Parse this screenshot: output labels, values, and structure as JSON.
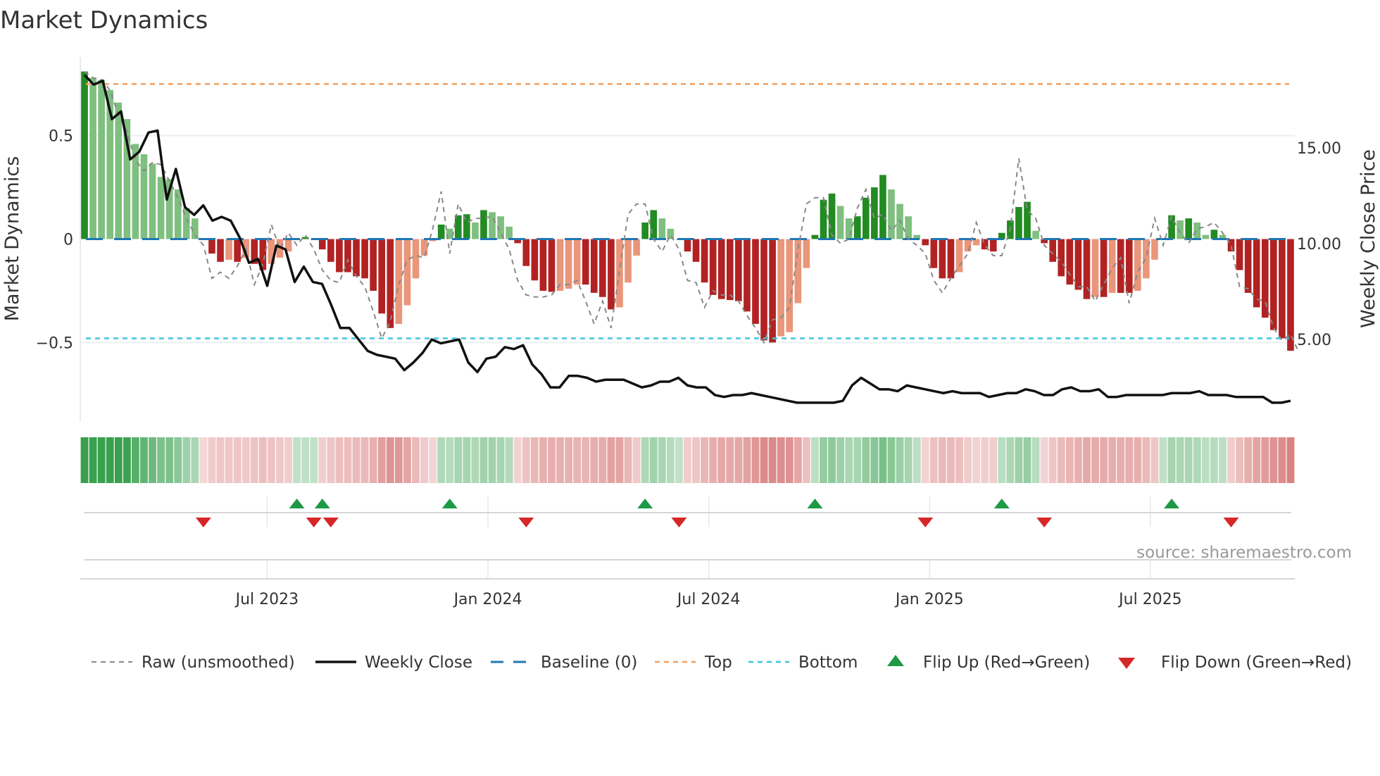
{
  "title": "Market Dynamics",
  "source": "source: sharemaestro.com",
  "chart_data": {
    "type": "bar",
    "title": "Market Dynamics",
    "ylabel": "Market Dynamics",
    "ylabel_right": "Weekly Close Price",
    "ylim": [
      -0.88,
      0.88
    ],
    "ylim_right": [
      0.74,
      19.74
    ],
    "yticks": [
      {
        "v": 0.5,
        "label": "0.5"
      },
      {
        "v": 0,
        "label": "0"
      },
      {
        "v": -0.5,
        "label": "−0.5"
      }
    ],
    "yticks_right": [
      {
        "v": 15,
        "label": "15.00"
      },
      {
        "v": 10,
        "label": "10.00"
      },
      {
        "v": 5,
        "label": "5.00"
      }
    ],
    "xticks": [
      {
        "week": 22,
        "label": "Jul 2023"
      },
      {
        "week": 48,
        "label": "Jan 2024"
      },
      {
        "week": 74,
        "label": "Jul 2024"
      },
      {
        "week": 100,
        "label": "Jan 2025"
      },
      {
        "week": 126,
        "label": "Jul 2025"
      }
    ],
    "top_level": 0.75,
    "bottom_level": -0.48,
    "baseline": 0,
    "values": [
      0.81,
      0.78,
      0.77,
      0.72,
      0.66,
      0.58,
      0.46,
      0.41,
      0.365,
      0.3,
      0.29,
      0.24,
      0.15,
      0.1,
      -0.005,
      -0.07,
      -0.11,
      -0.1,
      -0.11,
      -0.09,
      -0.12,
      -0.15,
      -0.12,
      -0.09,
      -0.06,
      0,
      0.01,
      0,
      -0.05,
      -0.11,
      -0.16,
      -0.16,
      -0.18,
      -0.19,
      -0.25,
      -0.36,
      -0.43,
      -0.41,
      -0.32,
      -0.19,
      -0.08,
      -0.01,
      0.07,
      0.05,
      0.115,
      0.12,
      0.08,
      0.14,
      0.13,
      0.11,
      0.06,
      -0.02,
      -0.13,
      -0.2,
      -0.25,
      -0.255,
      -0.25,
      -0.24,
      -0.22,
      -0.22,
      -0.26,
      -0.28,
      -0.34,
      -0.33,
      -0.21,
      -0.08,
      0.08,
      0.14,
      0.1,
      0.05,
      0,
      -0.06,
      -0.11,
      -0.21,
      -0.27,
      -0.29,
      -0.295,
      -0.3,
      -0.35,
      -0.41,
      -0.49,
      -0.5,
      -0.47,
      -0.45,
      -0.31,
      -0.14,
      0.02,
      0.19,
      0.22,
      0.16,
      0.1,
      0.11,
      0.2,
      0.25,
      0.31,
      0.24,
      0.17,
      0.11,
      0.02,
      -0.03,
      -0.14,
      -0.19,
      -0.19,
      -0.16,
      -0.06,
      -0.03,
      -0.05,
      -0.06,
      0.03,
      0.09,
      0.155,
      0.18,
      0.04,
      -0.02,
      -0.11,
      -0.18,
      -0.22,
      -0.245,
      -0.29,
      -0.28,
      -0.28,
      -0.26,
      -0.26,
      -0.26,
      -0.25,
      -0.19,
      -0.1,
      0,
      0.115,
      0.09,
      0.1,
      0.08,
      0.02,
      0.045,
      0.02,
      -0.06,
      -0.15,
      -0.26,
      -0.33,
      -0.38,
      -0.44,
      -0.48,
      -0.54
    ],
    "raw": [
      0.81,
      0.78,
      0.77,
      0.72,
      0.6,
      0.52,
      0.38,
      0.33,
      0.37,
      0.36,
      0.28,
      0.2,
      0.1,
      0.02,
      -0.03,
      -0.19,
      -0.16,
      -0.19,
      -0.13,
      -0.05,
      -0.22,
      -0.12,
      0.07,
      -0.05,
      0.03,
      -0.03,
      0.02,
      -0.05,
      -0.15,
      -0.2,
      -0.21,
      -0.1,
      -0.18,
      -0.23,
      -0.35,
      -0.48,
      -0.4,
      -0.22,
      -0.1,
      -0.08,
      -0.09,
      0.05,
      0.23,
      -0.07,
      0.17,
      0.08,
      0.1,
      0.1,
      0.11,
      0.03,
      -0.05,
      -0.2,
      -0.27,
      -0.28,
      -0.28,
      -0.27,
      -0.22,
      -0.22,
      -0.2,
      -0.3,
      -0.41,
      -0.3,
      -0.43,
      -0.15,
      0.12,
      0.17,
      0.17,
      0.0,
      -0.06,
      0.02,
      -0.05,
      -0.2,
      -0.21,
      -0.33,
      -0.25,
      -0.27,
      -0.27,
      -0.3,
      -0.37,
      -0.43,
      -0.5,
      -0.39,
      -0.38,
      -0.33,
      -0.05,
      0.17,
      0.2,
      0.2,
      0.02,
      -0.02,
      0.0,
      0.15,
      0.24,
      0.1,
      0.12,
      0.04,
      0.09,
      0.0,
      -0.03,
      -0.07,
      -0.2,
      -0.26,
      -0.19,
      -0.13,
      -0.07,
      0.08,
      -0.03,
      -0.08,
      -0.08,
      0.05,
      0.39,
      0.14,
      0.1,
      -0.03,
      -0.07,
      -0.11,
      -0.17,
      -0.23,
      -0.23,
      -0.3,
      -0.22,
      -0.14,
      -0.09,
      -0.31,
      -0.16,
      -0.09,
      0.1,
      -0.03,
      0.11,
      0.03,
      -0.02,
      0.05,
      0.06,
      0.08,
      0.03,
      -0.03,
      -0.23,
      -0.24,
      -0.29,
      -0.3,
      -0.43,
      -0.49,
      -0.46,
      -0.55
    ],
    "weekly_close": [
      18.8,
      18.3,
      18.5,
      16.5,
      16.9,
      14.4,
      14.8,
      15.8,
      15.9,
      12.3,
      13.9,
      11.9,
      11.5,
      12.0,
      11.2,
      11.4,
      11.2,
      10.3,
      9.0,
      9.2,
      7.8,
      9.9,
      9.7,
      8.0,
      8.8,
      8.0,
      7.9,
      6.8,
      5.6,
      5.6,
      5.0,
      4.4,
      4.2,
      4.1,
      4.0,
      3.4,
      3.8,
      4.3,
      5.0,
      4.8,
      4.9,
      5.0,
      3.8,
      3.3,
      4.0,
      4.1,
      4.6,
      4.5,
      4.7,
      3.7,
      3.2,
      2.5,
      2.5,
      3.1,
      3.1,
      3.0,
      2.8,
      2.9,
      2.9,
      2.9,
      2.7,
      2.5,
      2.6,
      2.8,
      2.8,
      3.0,
      2.6,
      2.5,
      2.5,
      2.1,
      2.0,
      2.1,
      2.1,
      2.2,
      2.1,
      2.0,
      1.9,
      1.8,
      1.7,
      1.7,
      1.7,
      1.7,
      1.7,
      1.8,
      2.6,
      3.0,
      2.7,
      2.4,
      2.4,
      2.3,
      2.6,
      2.5,
      2.4,
      2.3,
      2.2,
      2.3,
      2.2,
      2.2,
      2.2,
      2.0,
      2.1,
      2.2,
      2.2,
      2.4,
      2.3,
      2.1,
      2.1,
      2.4,
      2.5,
      2.3,
      2.3,
      2.4,
      2.0,
      2.0,
      2.1,
      2.1,
      2.1,
      2.1,
      2.1,
      2.2,
      2.2,
      2.2,
      2.3,
      2.1,
      2.1,
      2.1,
      2.0,
      2.0,
      2.0,
      2.0,
      1.7,
      1.7,
      1.8
    ],
    "flip_up_weeks": [
      25,
      28,
      43,
      66,
      86,
      108,
      128
    ],
    "flip_down_weeks": [
      14,
      27,
      29,
      52,
      70,
      99,
      113,
      135
    ]
  },
  "legend": [
    {
      "label": "Raw (unsmoothed)",
      "icon": "dashed-gray-line"
    },
    {
      "label": "Weekly Close",
      "icon": "solid-black-line"
    },
    {
      "label": "Baseline (0)",
      "icon": "dashed-blue-line"
    },
    {
      "label": "Top",
      "icon": "dotted-orange-line"
    },
    {
      "label": "Bottom",
      "icon": "dotted-cyan-line"
    },
    {
      "label": "Flip Up (Red→Green)",
      "icon": "green-up-triangle"
    },
    {
      "label": "Flip Down (Green→Red)",
      "icon": "red-down-triangle"
    }
  ],
  "colors": {
    "pos_rising": "#228b22",
    "pos_falling": "#7fbf7f",
    "neg_falling": "#b22222",
    "neg_rising": "#e9967a",
    "top": "#f0a060",
    "bottom": "#3ec6dc",
    "baseline": "#1f77b4",
    "flip_up": "#1e9a47",
    "flip_down": "#d62728",
    "raw": "#888888",
    "close": "#111111"
  }
}
